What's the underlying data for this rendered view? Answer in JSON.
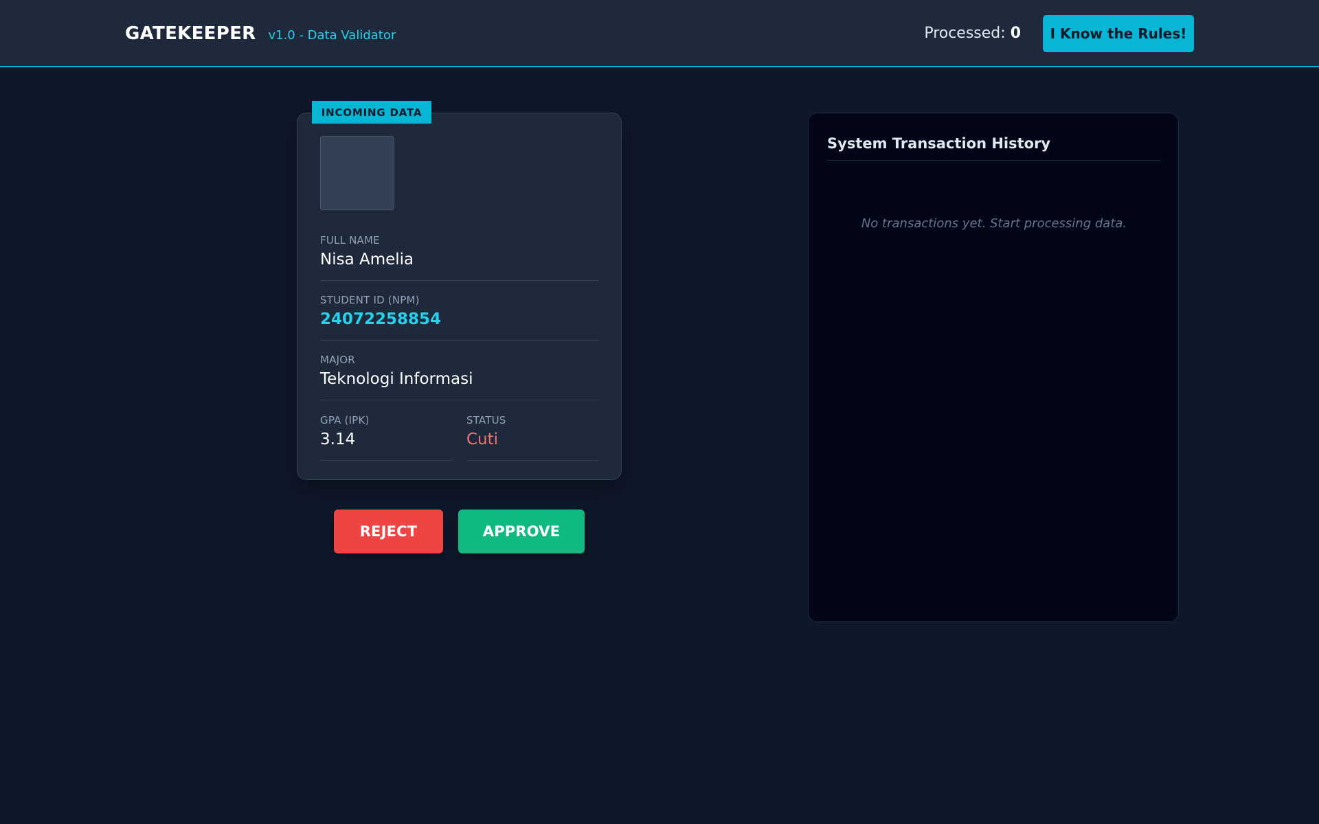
{
  "header": {
    "app_name": "GATEKEEPER",
    "version": "v1.0 - Data Validator",
    "processed_label": "Processed:",
    "processed_count": "0",
    "rules_button": "I Know the Rules!"
  },
  "card": {
    "badge": "INCOMING DATA",
    "fields": {
      "name_label": "FULL NAME",
      "name_value": "Nisa Amelia",
      "npm_label": "STUDENT ID (NPM)",
      "npm_value": "24072258854",
      "major_label": "MAJOR",
      "major_value": "Teknologi Informasi",
      "gpa_label": "GPA (IPK)",
      "gpa_value": "3.14",
      "status_label": "STATUS",
      "status_value": "Cuti"
    }
  },
  "actions": {
    "reject": "REJECT",
    "approve": "APPROVE"
  },
  "history": {
    "title": "System Transaction History",
    "empty_message": "No transactions yet. Start processing data."
  },
  "colors": {
    "accent": "#06b6d4",
    "reject": "#ef4444",
    "approve": "#10b981",
    "status_warning": "#f87171"
  }
}
